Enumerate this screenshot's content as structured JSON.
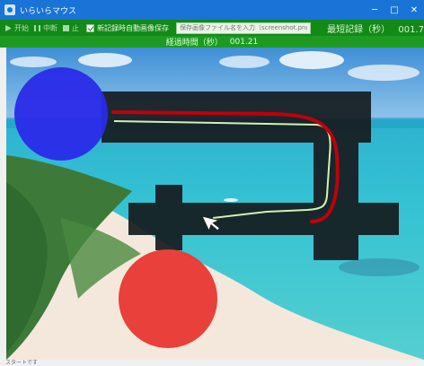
{
  "window": {
    "title": "いらいらマウス",
    "controls": {
      "minimize": "─",
      "maximize": "□",
      "close": "✕"
    }
  },
  "toolbar": {
    "start_label": "开始",
    "pause_label": "中断",
    "stop_label": "止",
    "autosave_label": "新記録時自動画像保存",
    "autosave_checked": true,
    "filename_placeholder": "保存画像ファイル名を入力（screenshot.png）",
    "best_label": "最短記録（秒）",
    "best_value": "001.7"
  },
  "timer": {
    "label": "経過時間（秒）",
    "value": "001.21"
  },
  "course": {
    "start_color": "#2a2ae8",
    "goal_color": "#e83a36",
    "wall_color": "#151b1f",
    "trail_color": "#c0000a",
    "guide_color": "#d6f0b4",
    "cursor_icon": "mouse-cursor-icon",
    "background_scene": "tropical beach and turquoise sea"
  },
  "status": {
    "text": "スタートです"
  }
}
